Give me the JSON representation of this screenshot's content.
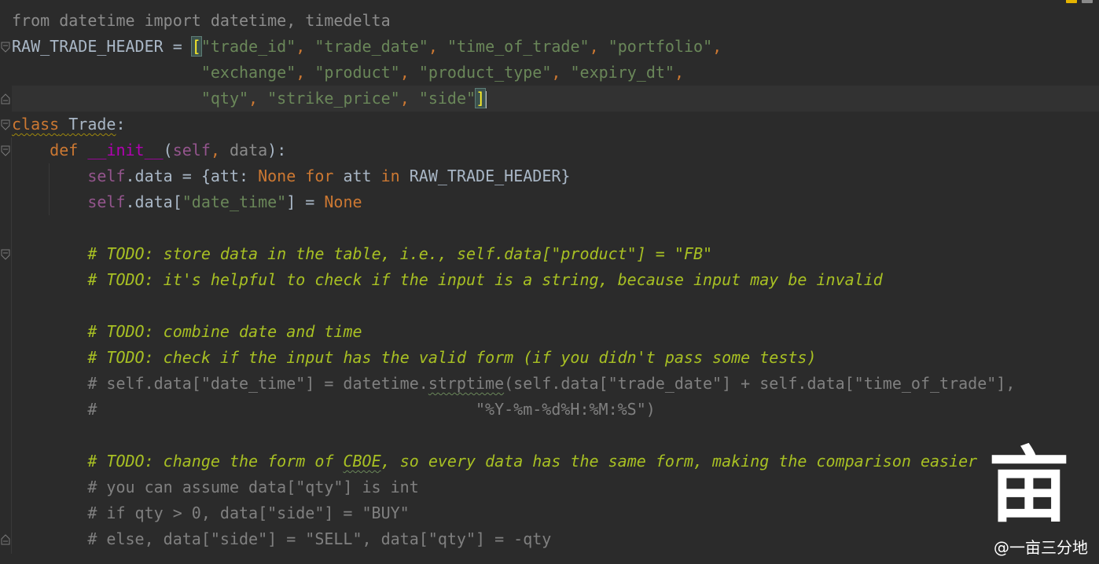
{
  "editor": {
    "language": "python",
    "colors": {
      "background": "#2b2b2b",
      "text": "#a9b7c6",
      "keyword": "#cc7832",
      "string": "#6a8759",
      "self": "#94558d",
      "dunder": "#b200b2",
      "comment": "#808080",
      "todo": "#a8c023"
    },
    "lines": [
      [
        {
          "t": "from datetime import datetime, timedelta",
          "c": "dim"
        }
      ],
      [
        {
          "t": "RAW_TRADE_HEADER = ",
          "c": "fn"
        },
        {
          "t": "[",
          "c": "bracket-hl"
        },
        {
          "t": "\"trade_id\"",
          "c": "str"
        },
        {
          "t": ", ",
          "c": "kw"
        },
        {
          "t": "\"trade_date\"",
          "c": "str"
        },
        {
          "t": ", ",
          "c": "kw"
        },
        {
          "t": "\"time_of_trade\"",
          "c": "str"
        },
        {
          "t": ", ",
          "c": "kw"
        },
        {
          "t": "\"portfolio\"",
          "c": "str"
        },
        {
          "t": ",",
          "c": "kw"
        }
      ],
      [
        {
          "t": "                    ",
          "c": "fn"
        },
        {
          "t": "\"exchange\"",
          "c": "str"
        },
        {
          "t": ", ",
          "c": "kw"
        },
        {
          "t": "\"product\"",
          "c": "str"
        },
        {
          "t": ", ",
          "c": "kw"
        },
        {
          "t": "\"product_type\"",
          "c": "str"
        },
        {
          "t": ", ",
          "c": "kw"
        },
        {
          "t": "\"expiry_dt\"",
          "c": "str"
        },
        {
          "t": ",",
          "c": "kw"
        }
      ],
      [
        {
          "t": "                    ",
          "c": "fn"
        },
        {
          "t": "\"qty\"",
          "c": "str"
        },
        {
          "t": ", ",
          "c": "kw"
        },
        {
          "t": "\"strike_price\"",
          "c": "str"
        },
        {
          "t": ", ",
          "c": "kw"
        },
        {
          "t": "\"side\"",
          "c": "str"
        },
        {
          "t": "]",
          "c": "bracket-hl"
        },
        {
          "t": "",
          "c": "caret"
        }
      ],
      [
        {
          "t": "class",
          "c": "kw squig"
        },
        {
          "t": " ",
          "c": "fn squig"
        },
        {
          "t": "Trade",
          "c": "fn squig"
        },
        {
          "t": ":",
          "c": "fn"
        }
      ],
      [
        {
          "t": "    ",
          "c": "fn"
        },
        {
          "t": "def ",
          "c": "kw"
        },
        {
          "t": "__init__",
          "c": "dunder"
        },
        {
          "t": "(",
          "c": "fn"
        },
        {
          "t": "self",
          "c": "self"
        },
        {
          "t": ", ",
          "c": "kw"
        },
        {
          "t": "data",
          "c": "paramdim"
        },
        {
          "t": "):",
          "c": "fn"
        }
      ],
      [
        {
          "t": "        ",
          "c": "fn"
        },
        {
          "t": "self",
          "c": "self"
        },
        {
          "t": ".data = {att: ",
          "c": "fn"
        },
        {
          "t": "None ",
          "c": "kw"
        },
        {
          "t": "for ",
          "c": "kw"
        },
        {
          "t": "att ",
          "c": "fn"
        },
        {
          "t": "in ",
          "c": "kw"
        },
        {
          "t": "RAW_TRADE_HEADER}",
          "c": "fn"
        }
      ],
      [
        {
          "t": "        ",
          "c": "fn"
        },
        {
          "t": "self",
          "c": "self"
        },
        {
          "t": ".data[",
          "c": "fn"
        },
        {
          "t": "\"date_time\"",
          "c": "str"
        },
        {
          "t": "] = ",
          "c": "fn"
        },
        {
          "t": "None",
          "c": "kw"
        }
      ],
      [],
      [
        {
          "t": "        # ",
          "c": "todo"
        },
        {
          "t": "TODO: store data in the table, i.e., self.data[\"product\"] = \"FB\"",
          "c": "todo"
        }
      ],
      [
        {
          "t": "        # ",
          "c": "todo"
        },
        {
          "t": "TODO: it's helpful to check if the input is a string, because input may be invalid",
          "c": "todo"
        }
      ],
      [],
      [
        {
          "t": "        # ",
          "c": "todo"
        },
        {
          "t": "TODO: combine date and time",
          "c": "todo"
        }
      ],
      [
        {
          "t": "        # ",
          "c": "todo"
        },
        {
          "t": "TODO: check if the input has the valid form (if you didn't pass some tests)",
          "c": "todo"
        }
      ],
      [
        {
          "t": "        # self.data[\"date_time\"] = datetime.",
          "c": "cm"
        },
        {
          "t": "strptime",
          "c": "cm squig-gr"
        },
        {
          "t": "(self.data[\"trade_date\"] + self.data[\"time_of_trade\"],",
          "c": "cm"
        }
      ],
      [
        {
          "t": "        #                                        \"%Y-%m-%d%H:%M:%S\")",
          "c": "cm"
        }
      ],
      [],
      [
        {
          "t": "        # ",
          "c": "todo"
        },
        {
          "t": "TODO: change the form of ",
          "c": "todo"
        },
        {
          "t": "CBOE",
          "c": "todo squig-gr"
        },
        {
          "t": ", so every data has the same form, making the comparison easier",
          "c": "todo"
        }
      ],
      [
        {
          "t": "        # you can assume data[\"qty\"] is int",
          "c": "cm"
        }
      ],
      [
        {
          "t": "        # if qty > 0, data[\"side\"] = \"BUY\"",
          "c": "cm"
        }
      ],
      [
        {
          "t": "        # else, data[\"side\"] = \"SELL\", data[\"qty\"] = -qty",
          "c": "cm"
        }
      ]
    ],
    "current_line_index": 3,
    "fold_markers": [
      {
        "line": 1,
        "icon": "fold-open-icon"
      },
      {
        "line": 3,
        "icon": "fold-close-icon"
      },
      {
        "line": 4,
        "icon": "fold-open-icon"
      },
      {
        "line": 5,
        "icon": "fold-open-icon"
      },
      {
        "line": 9,
        "icon": "fold-open-icon"
      },
      {
        "line": 20,
        "icon": "fold-close-icon"
      }
    ]
  },
  "inspection_indicators": [
    {
      "icon": "warning-icon",
      "color": "#e5b400"
    },
    {
      "icon": "typo-icon",
      "color": "#8a8a8a"
    }
  ],
  "watermark": {
    "glyph": "亩",
    "text": "@一亩三分地"
  }
}
